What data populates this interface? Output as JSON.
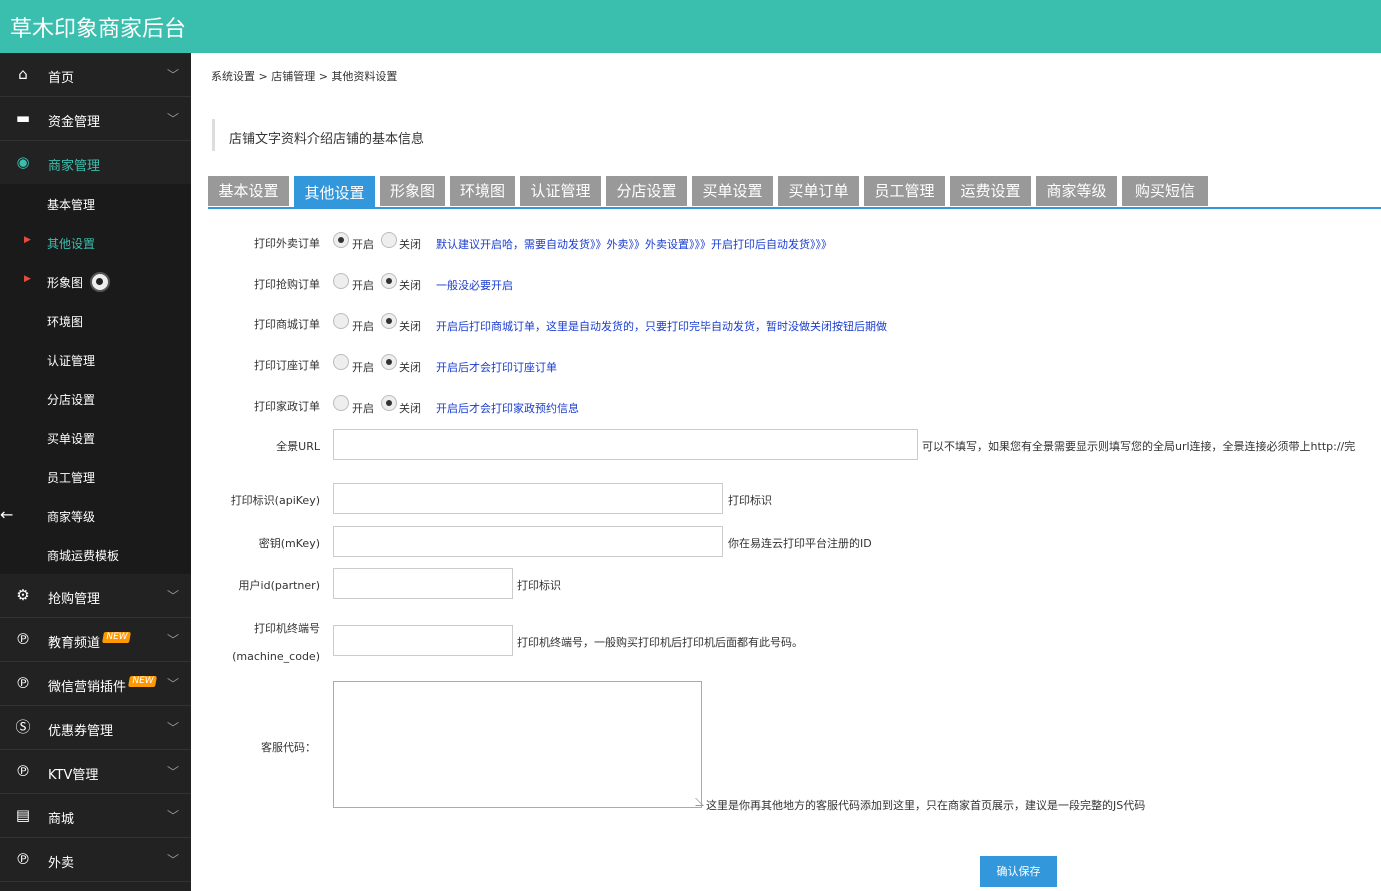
{
  "header": {
    "title": "草木印象商家后台"
  },
  "sidebar": {
    "menu": [
      {
        "label": "首页",
        "icon": "home-icon"
      },
      {
        "label": "资金管理",
        "icon": "card-icon"
      },
      {
        "label": "商家管理",
        "icon": "user-circle-icon"
      }
    ],
    "submenu": [
      "基本管理",
      "其他设置",
      "形象图",
      "环境图",
      "认证管理",
      "分店设置",
      "买单设置",
      "员工管理",
      "商家等级",
      "商城运费模板"
    ],
    "menu2": [
      {
        "label": "抢购管理",
        "icon": "gear-icon",
        "badge": ""
      },
      {
        "label": "教育频道",
        "icon": "p-circle-icon",
        "badge": "NEW"
      },
      {
        "label": "微信营销插件",
        "icon": "p-circle-icon",
        "badge": "NEW"
      },
      {
        "label": "优惠券管理",
        "icon": "s-circle-icon",
        "badge": ""
      },
      {
        "label": "KTV管理",
        "icon": "p-circle-icon",
        "badge": ""
      },
      {
        "label": "商城",
        "icon": "store-icon",
        "badge": ""
      },
      {
        "label": "外卖",
        "icon": "p-circle-icon",
        "badge": ""
      }
    ],
    "back_arrow": "←",
    "colors": {
      "accent": "#3ABFAE",
      "sidebar_bg": "#222222"
    }
  },
  "breadcrumb": "系统设置 > 店铺管理 > 其他资料设置",
  "section_title": "店铺文字资料介绍店铺的基本信息",
  "tabs": [
    "基本设置",
    "其他设置",
    "形象图",
    "环境图",
    "认证管理",
    "分店设置",
    "买单设置",
    "买单订单",
    "员工管理",
    "运费设置",
    "商家等级",
    "购买短信"
  ],
  "active_tab": "其他设置",
  "form": {
    "radio_on_label": "开启",
    "radio_off_label": "关闭",
    "radios": [
      {
        "label": "打印外卖订单",
        "value": "on",
        "hint": "默认建议开启哈，需要自动发货》》外卖》》外卖设置》》》开启打印后自动发货》》》"
      },
      {
        "label": "打印抢购订单",
        "value": "off",
        "hint": "一般没必要开启"
      },
      {
        "label": "打印商城订单",
        "value": "off",
        "hint": "开启后打印商城订单，这里是自动发货的，只要打印完毕自动发货，暂时没做关闭按钮后期做"
      },
      {
        "label": "打印订座订单",
        "value": "off",
        "hint": "开启后才会打印订座订单"
      },
      {
        "label": "打印家政订单",
        "value": "off",
        "hint": "开启后才会打印家政预约信息"
      }
    ],
    "fields": [
      {
        "label": "全景URL",
        "value": "",
        "note": "可以不填写，如果您有全景需要显示则填写您的全局url连接，全景连接必须带上http://完"
      },
      {
        "label": "打印标识(apiKey)",
        "value": "",
        "note": "打印标识"
      },
      {
        "label": "密钥(mKey)",
        "value": "",
        "note": "你在易连云打印平台注册的ID"
      },
      {
        "label": "用户id(partner)",
        "value": "",
        "note": "打印标识"
      },
      {
        "label_line1": "打印机终端号",
        "label_line2": "(machine_code)",
        "value": "",
        "note": "打印机终端号，一般购买打印机后打印机后面都有此号码。"
      }
    ],
    "kefu": {
      "label": "客服代码：",
      "value": "",
      "note": "这里是你再其他地方的客服代码添加到这里，只在商家首页展示，建议是一段完整的JS代码"
    },
    "save_label": "确认保存"
  }
}
